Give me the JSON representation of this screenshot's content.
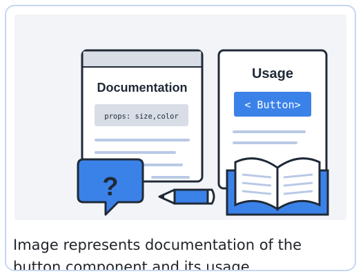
{
  "illustration": {
    "doc_title": "Documentation",
    "doc_code": "props: size,color",
    "usage_title": "Usage",
    "usage_button": "< Button>",
    "question_glyph": "?",
    "icons": [
      "document-page-icon",
      "usage-page-icon",
      "question-bubble-icon",
      "pencil-icon",
      "open-book-icon"
    ],
    "colors": {
      "accent_blue": "#3b82e8",
      "outline": "#1f2937",
      "code_bg": "#d8dde6",
      "line_light": "#b9c9e6",
      "panel_bg": "#f3f4f7",
      "card_border": "#c6d6f4"
    }
  },
  "caption": {
    "line1": "Image represents documentation of the",
    "line2": "button component and its usage."
  }
}
